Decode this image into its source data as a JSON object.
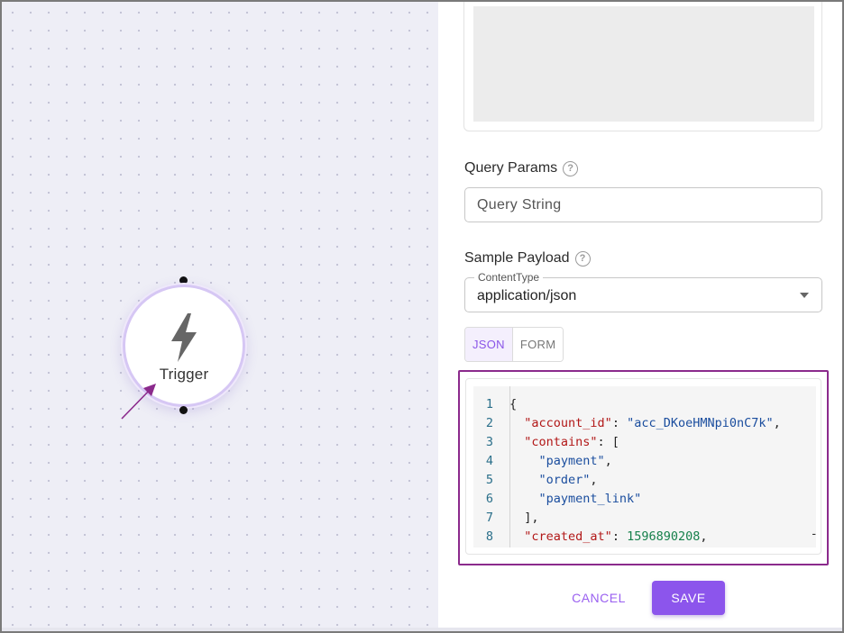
{
  "canvas": {
    "node": {
      "label": "Trigger",
      "icon": "lightning-bolt-icon"
    }
  },
  "panel": {
    "query_params": {
      "label": "Query Params",
      "help_icon": "?",
      "placeholder": "Query String"
    },
    "sample_payload": {
      "label": "Sample Payload",
      "help_icon": "?",
      "content_type": {
        "legend": "ContentType",
        "value": "application/json"
      },
      "tabs": [
        {
          "label": "JSON",
          "active": true
        },
        {
          "label": "FORM",
          "active": false
        }
      ]
    },
    "editor": {
      "lines": [
        {
          "n": "1",
          "segments": [
            {
              "t": "p",
              "v": "{"
            }
          ]
        },
        {
          "n": "2",
          "segments": [
            {
              "t": "p",
              "v": "  "
            },
            {
              "t": "k",
              "v": "\"account_id\""
            },
            {
              "t": "p",
              "v": ": "
            },
            {
              "t": "s",
              "v": "\"acc_DKoeHMNpi0nC7k\""
            },
            {
              "t": "p",
              "v": ","
            }
          ]
        },
        {
          "n": "3",
          "segments": [
            {
              "t": "p",
              "v": "  "
            },
            {
              "t": "k",
              "v": "\"contains\""
            },
            {
              "t": "p",
              "v": ": ["
            }
          ]
        },
        {
          "n": "4",
          "segments": [
            {
              "t": "p",
              "v": "    "
            },
            {
              "t": "s",
              "v": "\"payment\""
            },
            {
              "t": "p",
              "v": ","
            }
          ]
        },
        {
          "n": "5",
          "segments": [
            {
              "t": "p",
              "v": "    "
            },
            {
              "t": "s",
              "v": "\"order\""
            },
            {
              "t": "p",
              "v": ","
            }
          ]
        },
        {
          "n": "6",
          "segments": [
            {
              "t": "p",
              "v": "    "
            },
            {
              "t": "s",
              "v": "\"payment_link\""
            }
          ]
        },
        {
          "n": "7",
          "segments": [
            {
              "t": "p",
              "v": "  ],"
            }
          ]
        },
        {
          "n": "8",
          "segments": [
            {
              "t": "p",
              "v": "  "
            },
            {
              "t": "k",
              "v": "\"created_at\""
            },
            {
              "t": "p",
              "v": ": "
            },
            {
              "t": "n",
              "v": "1596890208"
            },
            {
              "t": "p",
              "v": ","
            }
          ]
        }
      ],
      "fold_marker": "-"
    },
    "actions": {
      "cancel_label": "CANCEL",
      "save_label": "SAVE"
    }
  },
  "colors": {
    "accent": "#8c55ec",
    "highlight_border": "#8b2a8c",
    "json_key": "#b21818",
    "json_string": "#1a4d9e",
    "json_number": "#16804b"
  }
}
